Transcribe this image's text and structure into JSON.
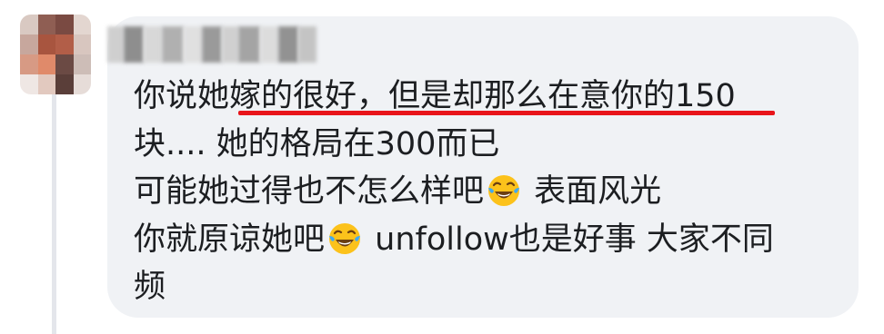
{
  "comment": {
    "author_name": "",
    "lines": [
      {
        "pre": "你说她",
        "underlined": "嫁的很好，但是却那么在意你的150",
        "post": ""
      },
      {
        "text": "块.... 她的格局在300而已"
      },
      {
        "pre": "可能她过得也不怎么样吧",
        "emoji": "face-with-tears-of-joy",
        "post": " 表面风光"
      },
      {
        "pre": "你就原谅她吧",
        "emoji": "face-with-tears-of-joy",
        "post": " unfollow也是好事 大家不同"
      },
      {
        "text": "频"
      }
    ]
  },
  "colors": {
    "bubble_bg": "#f0f2f5",
    "text": "#1c1e21",
    "underline": "#e8141a",
    "thread_line": "#e4e6eb"
  },
  "icons": {
    "avatar": "blurred-avatar",
    "emoji": "face-with-tears-of-joy-icon"
  }
}
